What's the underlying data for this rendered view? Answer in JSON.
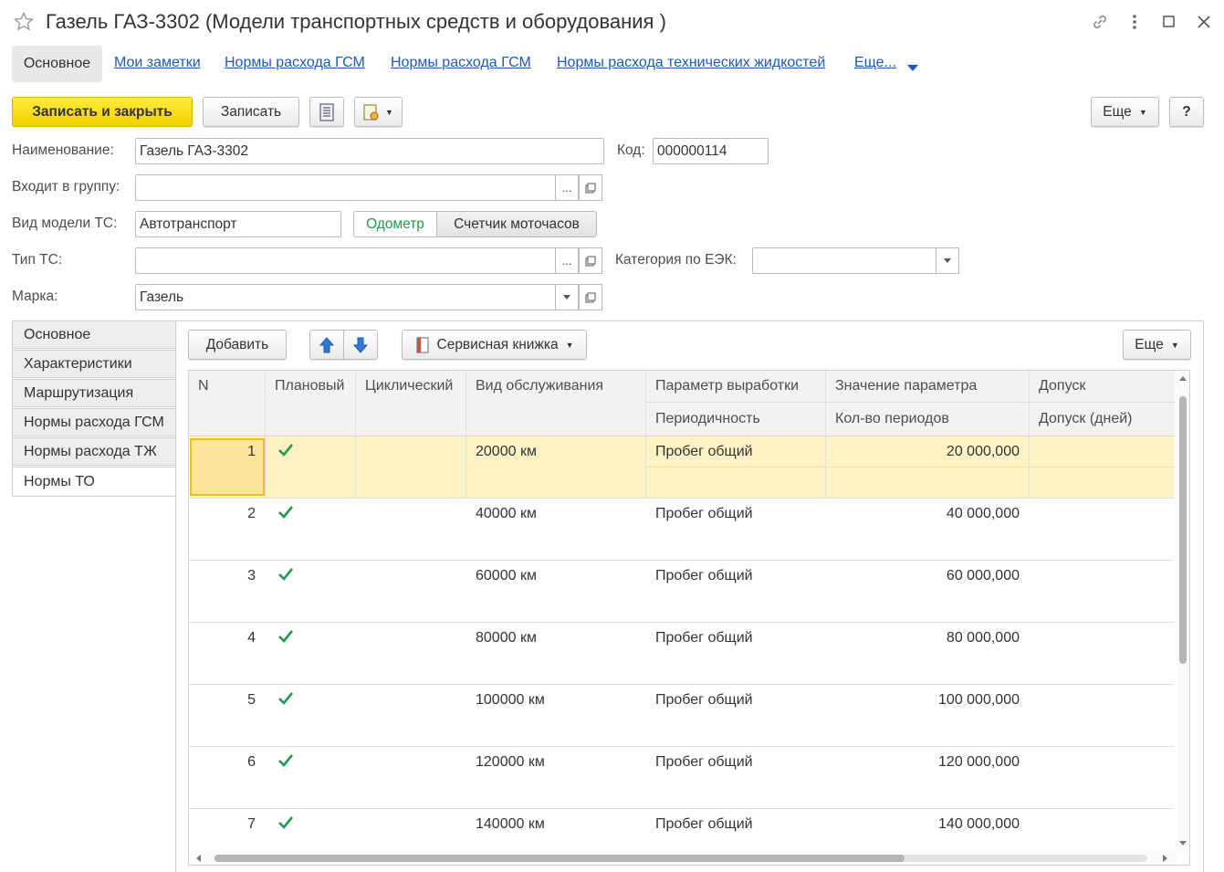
{
  "window": {
    "title": "Газель ГАЗ-3302 (Модели транспортных средств и оборудования )"
  },
  "nav": {
    "tabs": [
      "Основное",
      "Мои заметки",
      "Нормы расхода ГСМ",
      "Нормы расхода ГСМ",
      "Нормы расхода технических жидкостей",
      "Еще..."
    ]
  },
  "toolbar": {
    "save_close": "Записать и закрыть",
    "save": "Записать",
    "more": "Еще",
    "help": "?"
  },
  "form": {
    "name_label": "Наименование:",
    "name_value": "Газель ГАЗ-3302",
    "code_label": "Код:",
    "code_value": "000000114",
    "group_label": "Входит в группу:",
    "group_value": "",
    "model_type_label": "Вид модели ТС:",
    "model_type_value": "Автотранспорт",
    "odometer_label": "Одометр",
    "hours_label": "Счетчик моточасов",
    "type_label": "Тип ТС:",
    "type_value": "",
    "category_label": "Категория по ЕЭК:",
    "category_value": "",
    "brand_label": "Марка:",
    "brand_value": "Газель",
    "ellipsis": "..."
  },
  "side_tabs": [
    "Основное",
    "Характеристики",
    "Маршрутизация",
    "Нормы расхода ГСМ",
    "Нормы расхода ТЖ",
    "Нормы ТО"
  ],
  "table_toolbar": {
    "add": "Добавить",
    "service_book": "Сервисная книжка",
    "more": "Еще"
  },
  "table": {
    "headers": {
      "n": "N",
      "planned": "Плановый",
      "cyclic": "Циклический",
      "service_type": "Вид обслуживания",
      "param": "Параметр выработки",
      "periodicity": "Периодичность",
      "param_value": "Значение параметра",
      "period_count": "Кол-во периодов",
      "tolerance": "Допуск",
      "tolerance_days": "Допуск (дней)"
    },
    "rows": [
      {
        "n": "1",
        "planned": true,
        "service": "20000 км",
        "param": "Пробег общий",
        "value": "20 000,000"
      },
      {
        "n": "2",
        "planned": true,
        "service": "40000 км",
        "param": "Пробег общий",
        "value": "40 000,000"
      },
      {
        "n": "3",
        "planned": true,
        "service": "60000 км",
        "param": "Пробег общий",
        "value": "60 000,000"
      },
      {
        "n": "4",
        "planned": true,
        "service": "80000 км",
        "param": "Пробег общий",
        "value": "80 000,000"
      },
      {
        "n": "5",
        "planned": true,
        "service": "100000 км",
        "param": "Пробег общий",
        "value": "100 000,000"
      },
      {
        "n": "6",
        "planned": true,
        "service": "120000 км",
        "param": "Пробег общий",
        "value": "120 000,000"
      },
      {
        "n": "7",
        "planned": true,
        "service": "140000 км",
        "param": "Пробег общий",
        "value": "140 000,000"
      }
    ]
  },
  "colors": {
    "accent_yellow": "#f5d90a",
    "link_blue": "#1c5ab5",
    "check_green": "#1e9b4b",
    "selected_row": "#fdf2c4"
  }
}
